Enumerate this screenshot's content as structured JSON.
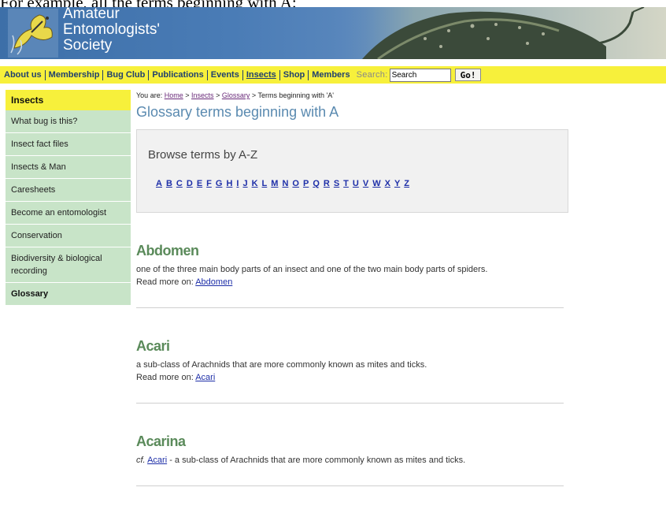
{
  "top_text": "For example, all the terms beginning with A:",
  "header": {
    "title_lines": [
      "Amateur",
      "Entomologists'",
      "Society"
    ]
  },
  "nav": {
    "items": [
      "About us",
      "Membership",
      "Bug Club",
      "Publications",
      "Events",
      "Insects",
      "Shop",
      "Members"
    ],
    "current": "Insects",
    "search_label": "Search:",
    "search_value": "Search",
    "go_label": "Go!"
  },
  "sidebar": {
    "heading": "Insects",
    "items": [
      "What bug is this?",
      "Insect fact files",
      "Insects & Man",
      "Caresheets",
      "Become an entomologist",
      "Conservation",
      "Biodiversity & biological recording",
      "Glossary"
    ],
    "selected": "Glossary"
  },
  "breadcrumb": {
    "prefix": "You are:",
    "home": "Home",
    "insects": "Insects",
    "glossary": "Glossary",
    "current": "Terms beginning with 'A'"
  },
  "page_title": "Glossary terms beginning with A",
  "az": {
    "title": "Browse terms by A-Z",
    "letters": [
      "A",
      "B",
      "C",
      "D",
      "E",
      "F",
      "G",
      "H",
      "I",
      "J",
      "K",
      "L",
      "M",
      "N",
      "O",
      "P",
      "Q",
      "R",
      "S",
      "T",
      "U",
      "V",
      "W",
      "X",
      "Y",
      "Z"
    ]
  },
  "terms": [
    {
      "name": "Abdomen",
      "definition": "one of the three main body parts of an insect and one of the two main body parts of spiders.",
      "more_label": "Read more on:",
      "more_link": "Abdomen"
    },
    {
      "name": "Acari",
      "definition": "a sub-class of Arachnids that are more commonly known as mites and ticks.",
      "more_label": "Read more on:",
      "more_link": "Acari"
    },
    {
      "name": "Acarina",
      "cf_label": "cf.",
      "cf_link": "Acari",
      "definition": " - a sub-class of Arachnids that are more commonly known as mites and ticks."
    }
  ],
  "colors": {
    "navbar": "#f7f03b",
    "sidebar_item": "#c8e4c8",
    "title": "#5a8ab0",
    "term_heading": "#5a8a5a",
    "link": "#1e2fa8"
  }
}
